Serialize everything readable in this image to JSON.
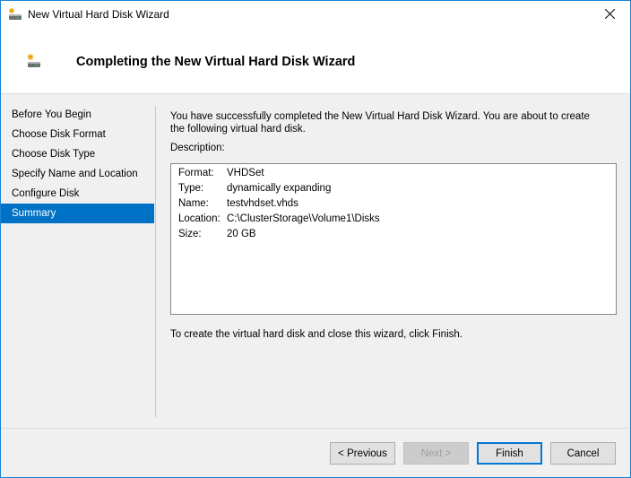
{
  "window": {
    "title": "New Virtual Hard Disk Wizard",
    "icon": "hard-disk-new-icon",
    "close_glyph": "✕"
  },
  "header": {
    "title": "Completing the New Virtual Hard Disk Wizard",
    "icon": "hard-disk-new-icon"
  },
  "nav": {
    "items": [
      {
        "label": "Before You Begin",
        "active": false
      },
      {
        "label": "Choose Disk Format",
        "active": false
      },
      {
        "label": "Choose Disk Type",
        "active": false
      },
      {
        "label": "Specify Name and Location",
        "active": false
      },
      {
        "label": "Configure Disk",
        "active": false
      },
      {
        "label": "Summary",
        "active": true
      }
    ]
  },
  "content": {
    "intro": "You have successfully completed the New Virtual Hard Disk Wizard. You are about to create the following virtual hard disk.",
    "description_label": "Description:",
    "description": [
      {
        "key": "Format:",
        "value": "VHDSet"
      },
      {
        "key": "Type:",
        "value": "dynamically expanding"
      },
      {
        "key": "Name:",
        "value": "testvhdset.vhds"
      },
      {
        "key": "Location:",
        "value": "C:\\ClusterStorage\\Volume1\\Disks"
      },
      {
        "key": "Size:",
        "value": "20 GB"
      }
    ],
    "footer": "To create the virtual hard disk and close this wizard, click Finish."
  },
  "buttons": {
    "previous": "< Previous",
    "next": "Next >",
    "finish": "Finish",
    "cancel": "Cancel"
  },
  "colors": {
    "accent": "#0078d7",
    "selection": "#0072c6",
    "window_border": "#1883d7"
  }
}
